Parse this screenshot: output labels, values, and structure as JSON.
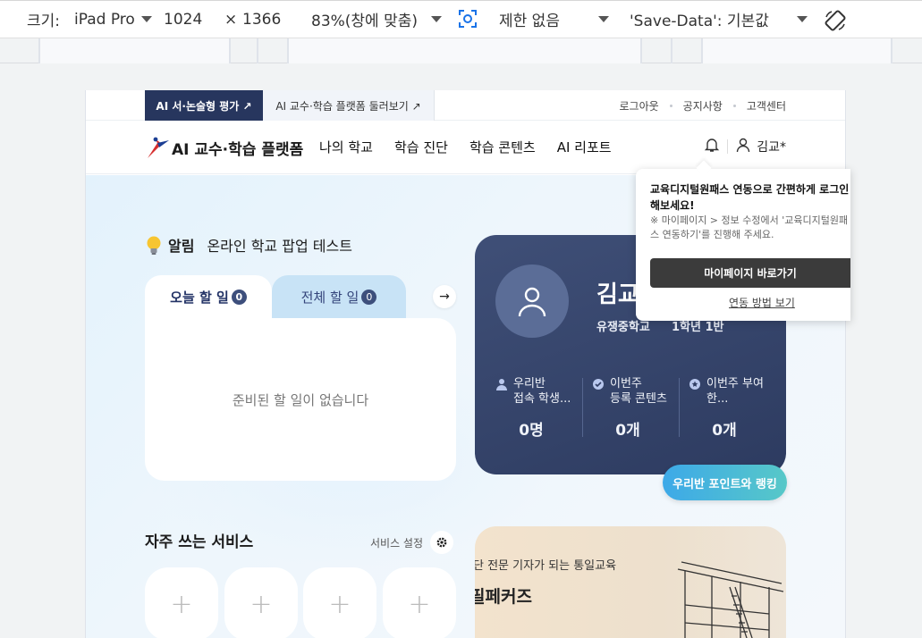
{
  "devtools": {
    "size_label": "크기:",
    "device": "iPad Pro",
    "width": "1024",
    "times": "×",
    "height": "1366",
    "zoom": "83%(창에 맞춤)",
    "throttle": "제한 없음",
    "save_data": "'Save-Data': 기본값"
  },
  "topbar": {
    "tab_essay": "AI 서·논술형 평가 ↗",
    "tab_tour": "AI 교수·학습 플랫폼 둘러보기 ↗",
    "logout": "로그아웃",
    "notice": "공지사항",
    "support": "고객센터"
  },
  "gnb": {
    "logo_text": "AI 교수·학습 플랫폼",
    "menu": [
      "나의 학교",
      "학습 진단",
      "학습 콘텐츠",
      "AI 리포트"
    ],
    "user_name": "김교*"
  },
  "notice": {
    "label": "알림",
    "text": "온라인 학교 팝업 테스트"
  },
  "todo": {
    "tab_today": "오늘 할 일",
    "today_count": "0",
    "tab_all": "전체 할 일",
    "all_count": "0",
    "arrow": "→",
    "empty": "준비된 할 일이 없습니다"
  },
  "profile": {
    "name": "김교",
    "school": "유쟁중학교",
    "grade": "1학년 1반",
    "stats": [
      {
        "label1": "우리반",
        "label2": "접속 학생...",
        "value": "0명"
      },
      {
        "label1": "이번주",
        "label2": "등록 콘텐츠",
        "value": "0개"
      },
      {
        "label1": "이번주 부여",
        "label2": "한...",
        "value": "0개"
      }
    ]
  },
  "rank_button": "우리반 포인트와 랭킹",
  "services": {
    "title": "자주 쓰는 서비스",
    "settings": "서비스 설정",
    "plus": "+"
  },
  "banner": {
    "line1": "단 전문 기자가 되는 통일교육",
    "line2": "필페커즈"
  },
  "popover": {
    "title": "교육디지털원패스 연동으로 간편하게 로그인 해보세요!",
    "desc": "※ 마이페이지 > 정보 수정에서 '교육디지털원패스 연동하기'를 진행해 주세요.",
    "button": "마이페이지 바로가기",
    "link": "연동 방법 보기"
  },
  "colors": {
    "navy": "#27365e",
    "profile_bg": "#3f4f77",
    "accent_gradient_start": "#3da9e8",
    "accent_gradient_end": "#57c8c8"
  }
}
